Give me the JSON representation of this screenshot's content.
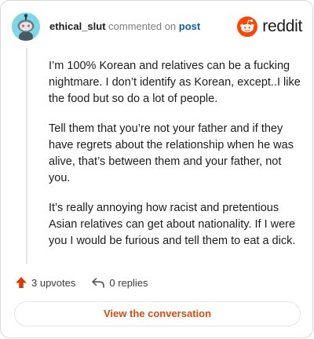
{
  "header": {
    "username": "ethical_slut",
    "commented_on": "commented on",
    "post_link": "post",
    "brand": "reddit"
  },
  "comment": {
    "paragraphs": [
      "I’m 100% Korean and relatives can be a fucking nightmare. I don’t identify as Korean, except..I like the food but so do a lot of people.",
      "Tell them that you’re not your father and if they have regrets about the relationship when he was alive, that’s between them and your father, not you.",
      "It’s really annoying how racist and pretentious Asian relatives can get about nationality. If I were you I would be furious and tell them to eat a dick."
    ]
  },
  "actions": {
    "upvotes": "3 upvotes",
    "replies": "0 replies"
  },
  "cta": {
    "label": "View the conversation"
  },
  "colors": {
    "reddit_orange": "#ff4500",
    "upvote": "#d93a00",
    "cta_text": "#d44e10",
    "post_link": "#0a5fa8"
  }
}
